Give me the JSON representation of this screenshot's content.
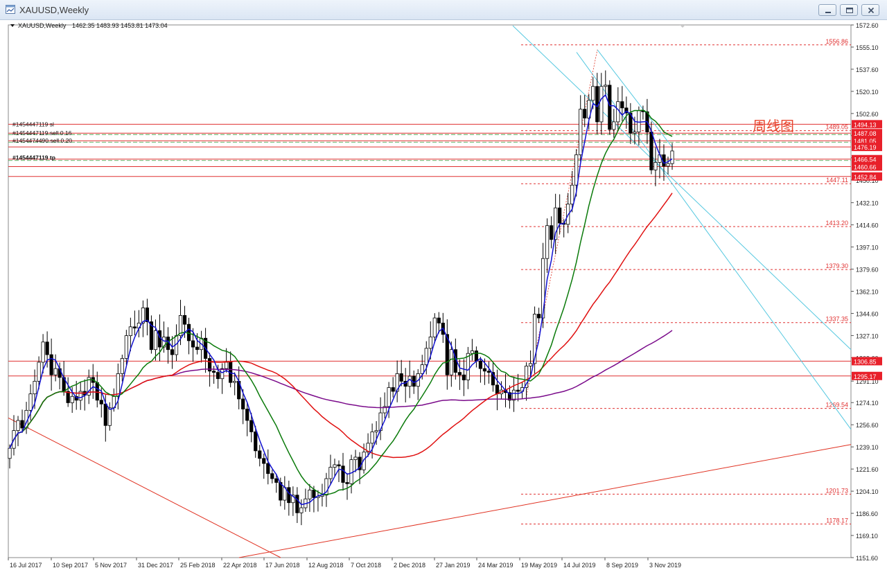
{
  "window": {
    "title": "XAUUSD,Weekly",
    "minimize_icon": "minimize-icon",
    "restore_icon": "restore-icon",
    "close_icon": "close-icon"
  },
  "chart_header": {
    "symbol_label": "XAUUSD,Weekly",
    "ohlc": "1462.35 1483.93 1453.81 1473.04"
  },
  "annotation": "周线图",
  "colors": {
    "bull_candle": "#ffffff",
    "bear_candle": "#000000",
    "ma_fast": "#1010d0",
    "ma_medium": "#0a7a0a",
    "ma_slow": "#e01010",
    "ma_long": "#7a0a8a",
    "trendline_cyan": "#55c8e0",
    "trendline_red": "#e03020",
    "level_line": "#e03030"
  },
  "chart_data": {
    "type": "candlestick",
    "symbol": "XAUUSD",
    "timeframe": "Weekly",
    "ylim": [
      1151.6,
      1572.6
    ],
    "y_ticks": [
      "1572.60",
      "1555.10",
      "1537.60",
      "1520.10",
      "1502.60",
      "1485.10",
      "1467.60",
      "1450.10",
      "1432.10",
      "1414.60",
      "1397.10",
      "1379.60",
      "1362.10",
      "1344.60",
      "1327.10",
      "1309.60",
      "1291.10",
      "1274.10",
      "1256.60",
      "1239.10",
      "1221.60",
      "1204.10",
      "1186.60",
      "1169.10",
      "1151.60"
    ],
    "x_ticks": [
      "16 Jul 2017",
      "10 Sep 2017",
      "5 Nov 2017",
      "31 Dec 2017",
      "25 Feb 2018",
      "22 Apr 2018",
      "17 Jun 2018",
      "12 Aug 2018",
      "7 Oct 2018",
      "2 Dec 2018",
      "27 Jan 2019",
      "24 Mar 2019",
      "19 May 2019",
      "14 Jul 2019",
      "8 Sep 2019",
      "3 Nov 2019"
    ],
    "dashed_levels": [
      "1556.86",
      "1489.05",
      "1447.11",
      "1413.20",
      "1379.30",
      "1337.35",
      "1269.54",
      "1201.73",
      "1178.17"
    ],
    "price_boxes": [
      "1494.13",
      "1487.08",
      "1481.05",
      "1476.19",
      "1466.54",
      "1460.66",
      "1452.84",
      "1306.85",
      "1295.17"
    ],
    "order_labels": [
      "#1454447119 sl",
      "#1454447119 sell 0.16",
      "#1454474490 sell 0.20",
      "#1454447119 tp"
    ],
    "closes": [
      1238,
      1252,
      1260,
      1254,
      1268,
      1281,
      1291,
      1306,
      1322,
      1312,
      1296,
      1301,
      1294,
      1283,
      1274,
      1279,
      1276,
      1283,
      1280,
      1294,
      1290,
      1276,
      1273,
      1256,
      1270,
      1279,
      1297,
      1309,
      1327,
      1334,
      1333,
      1337,
      1349,
      1338,
      1316,
      1331,
      1318,
      1326,
      1316,
      1312,
      1327,
      1343,
      1336,
      1323,
      1318,
      1316,
      1325,
      1309,
      1299,
      1298,
      1293,
      1301,
      1306,
      1290,
      1291,
      1277,
      1269,
      1260,
      1251,
      1236,
      1230,
      1226,
      1218,
      1214,
      1211,
      1197,
      1207,
      1195,
      1201,
      1187,
      1191,
      1198,
      1205,
      1199,
      1200,
      1201,
      1214,
      1223,
      1225,
      1224,
      1211,
      1210,
      1229,
      1231,
      1221,
      1235,
      1242,
      1251,
      1252,
      1266,
      1271,
      1286,
      1283,
      1297,
      1291,
      1287,
      1295,
      1287,
      1297,
      1304,
      1317,
      1326,
      1341,
      1337,
      1328,
      1296,
      1316,
      1298,
      1296,
      1292,
      1313,
      1315,
      1307,
      1301,
      1299,
      1298,
      1288,
      1281,
      1284,
      1282,
      1276,
      1284,
      1283,
      1286,
      1303,
      1305,
      1344,
      1341,
      1388,
      1414,
      1403,
      1428,
      1416,
      1415,
      1431,
      1446,
      1470,
      1506,
      1499,
      1513,
      1524,
      1496,
      1524,
      1525,
      1490,
      1496,
      1512,
      1507,
      1503,
      1487,
      1488,
      1505,
      1504,
      1488,
      1458,
      1464,
      1470,
      1461,
      1463,
      1473
    ]
  }
}
